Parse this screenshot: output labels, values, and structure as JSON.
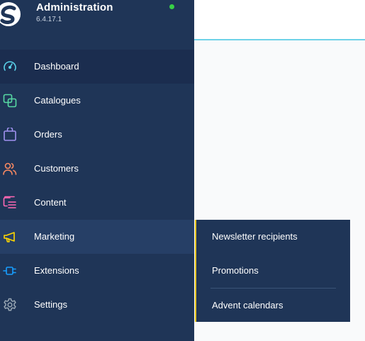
{
  "app": {
    "title": "Administration",
    "version": "6.4.17.1",
    "status_color": "#37d046",
    "accent_color": "#6ed2e8"
  },
  "sidebar": {
    "items": [
      {
        "label": "Dashboard",
        "icon": "gauge-icon",
        "color": "#5ad2ea",
        "state": "active"
      },
      {
        "label": "Catalogues",
        "icon": "catalogue-icon",
        "color": "#57d9a3"
      },
      {
        "label": "Orders",
        "icon": "shopping-bag-icon",
        "color": "#a092f0"
      },
      {
        "label": "Customers",
        "icon": "users-icon",
        "color": "#f88962"
      },
      {
        "label": "Content",
        "icon": "content-icon",
        "color": "#ff68b4"
      },
      {
        "label": "Marketing",
        "icon": "megaphone-icon",
        "color": "#ffd700",
        "state": "hover"
      },
      {
        "label": "Extensions",
        "icon": "plug-icon",
        "color": "#189eff"
      },
      {
        "label": "Settings",
        "icon": "gear-icon",
        "color": "#9aa8b5"
      }
    ]
  },
  "flyout": {
    "parent": "Marketing",
    "accent_color": "#f4c41c",
    "items": [
      {
        "label": "Newsletter recipients"
      },
      {
        "label": "Promotions"
      },
      {
        "label": "Advent calendars"
      }
    ]
  }
}
